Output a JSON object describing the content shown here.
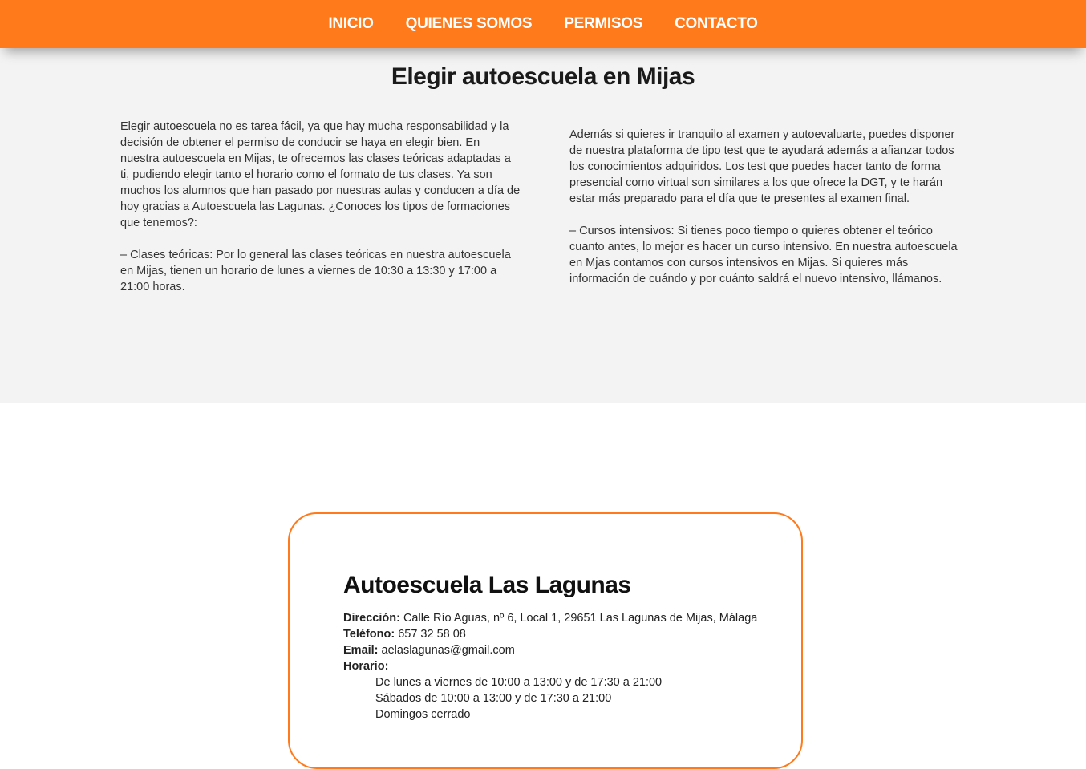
{
  "nav": {
    "items": [
      "INICIO",
      "QUIENES SOMOS",
      "PERMISOS",
      "CONTACTO"
    ]
  },
  "main": {
    "heading": "Elegir autoescuela en Mijas",
    "left_paragraphs": [
      "Elegir autoescuela no es tarea fácil, ya que hay mucha responsabilidad y la decisión de obtener el permiso de conducir se haya en elegir bien. En nuestra autoescuela en Mijas, te ofrecemos las clases teóricas adaptadas a ti, pudiendo elegir tanto el horario como el formato de tus clases. Ya son muchos los alumnos que han pasado por nuestras aulas y conducen a día de hoy gracias a Autoescuela las Lagunas. ¿Conoces los tipos de formaciones que tenemos?:",
      "– Clases teóricas: Por lo general las clases teóricas en nuestra autoescuela en Mijas, tienen un horario de lunes a viernes de 10:30 a 13:30 y 17:00 a 21:00 horas."
    ],
    "right_paragraphs": [
      "Además si quieres ir tranquilo al examen y autoevaluarte, puedes disponer de nuestra plataforma de tipo test que te ayudará además a afianzar todos los conocimientos adquiridos. Los test que puedes hacer tanto de forma presencial como virtual son similares a los que ofrece la DGT, y te harán estar más preparado para el día que te presentes al examen final.",
      "– Cursos intensivos: Si tienes poco tiempo o quieres obtener el teórico cuanto antes, lo mejor es hacer un curso intensivo. En nuestra autoescuela en Mjas contamos con cursos intensivos en Mijas. Si quieres más información de cuándo y por cuánto saldrá el nuevo intensivo, llámanos."
    ]
  },
  "contact": {
    "title": "Autoescuela Las Lagunas",
    "address_label": "Dirección:",
    "address": "Calle Río Aguas, nº 6, Local 1, 29651 Las Lagunas de Mijas, Málaga",
    "phone_label": "Teléfono:",
    "phone": "657 32 58 08",
    "email_label": "Email:",
    "email": "aelaslagunas@gmail.com",
    "hours_label": "Horario:",
    "hours": [
      "De lunes a viernes de 10:00 a 13:00 y de 17:30 a 21:00",
      "Sábados de 10:00 a 13:00 y de 17:30 a 21:00",
      "Domingos cerrado"
    ]
  },
  "colors": {
    "accent": "#ff7a1a",
    "section_bg": "#f3f3f3"
  }
}
